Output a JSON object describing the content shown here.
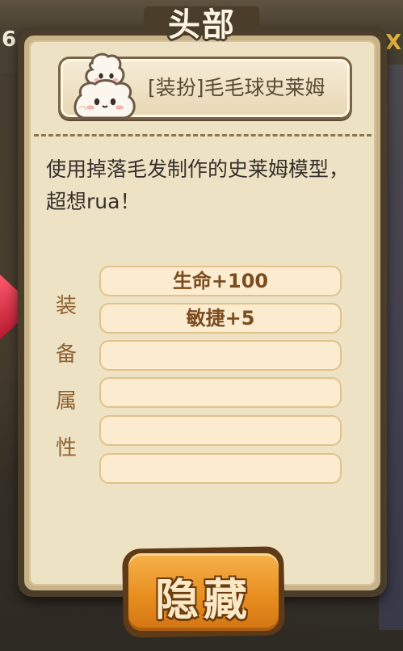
{
  "background": {
    "left_number": "6",
    "right_mark": "X"
  },
  "panel": {
    "title": "头部",
    "item_name": "[装扮]毛毛球史莱姆",
    "item_icon": "cream-slime-icon",
    "description": "使用掉落毛发制作的史莱姆模型，超想rua！"
  },
  "attributes": {
    "label_chars": [
      "装",
      "备",
      "属",
      "性"
    ],
    "slots": [
      "生命+100",
      "敏捷+5",
      "",
      "",
      "",
      ""
    ]
  },
  "actions": {
    "hide_label": "隐藏"
  },
  "colors": {
    "panel_border": "#4a3d2a",
    "paper": "#eee2c4",
    "slot_fill": "#fbecd0",
    "slot_text": "#7a4d20",
    "label_text": "#8e6334",
    "button_orange": "#e88f1f"
  }
}
